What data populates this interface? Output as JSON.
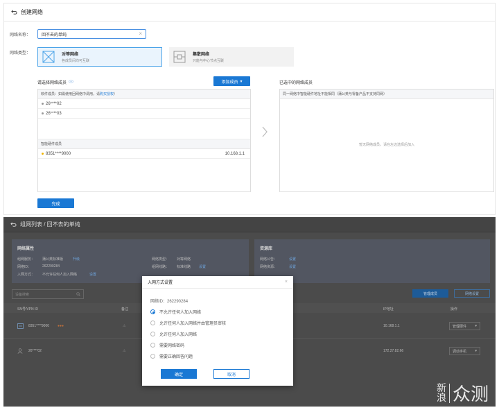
{
  "create": {
    "title": "创建网络",
    "name_label": "网络名称：",
    "name_value": "回不去的单纯",
    "type_label": "网络类型：",
    "types": [
      {
        "name": "对等网络",
        "desc": "各成员间均可互联"
      },
      {
        "name": "集散网络",
        "desc": "只能与中心节点互联"
      }
    ],
    "select_title": "请选择网络成员",
    "add_button": "添加成员",
    "software_header": "软件成员：如需使用回网络中调用，请",
    "software_header_link": "购买授权",
    "software_header_end": "）",
    "software_members": [
      "26****02",
      "26****03"
    ],
    "hardware_header": "智能硬件成员",
    "hardware_members": [
      {
        "id": "8351****9000",
        "ip": "10.168.1.1"
      }
    ],
    "selected_title": "已选中的网络成员",
    "selected_header": "同一网络中智能硬件地址不能相同（蒲公英与零备产品不支持同网）",
    "selected_empty": "暂无网络成员，请在左边选择后加入",
    "done_button": "完成"
  },
  "detail": {
    "title": "组网列表 / 回不去的单纯",
    "attr_title": "网络属性",
    "attr_rows": [
      {
        "label": "组网服务：",
        "value": "蒲公英标准版",
        "link": "升级"
      },
      {
        "label": "网络ID：",
        "value": "262290284",
        "link": ""
      },
      {
        "label": "入网方式：",
        "value": "不允许任何人加入网络",
        "link": "设置"
      }
    ],
    "attr_rows_right": [
      {
        "label": "网络类型：",
        "value": "对等网络",
        "link": ""
      },
      {
        "label": "组网线路：",
        "value": "标准线路",
        "link": "设置"
      },
      {
        "label": "限制：",
        "value": "硬件 1  软件 3",
        "link": ""
      }
    ],
    "resource_title": "资源库",
    "resource_rows": [
      {
        "label": "网络公告：",
        "link": "设置"
      },
      {
        "label": "网络资源：",
        "link": "设置"
      }
    ],
    "search_placeholder": "设备搜索",
    "manage_button": "管理成员",
    "delete_button": "网络设置",
    "col_id": "SN号/VPN ID",
    "col_note": "备注",
    "col_ip": "IP地址",
    "col_op": "操作",
    "rows": [
      {
        "id": "8351****9000",
        "badge": "●●●",
        "ip": "10.168.1.1",
        "op": "管理硬件"
      },
      {
        "id": "26****02",
        "badge": "",
        "ip": "172.27.82.66",
        "op": "调动手机"
      }
    ]
  },
  "modal": {
    "title": "入网方式设置",
    "id_line": "网络ID：262290284",
    "options": [
      "不允许任何人加入网络",
      "允许任何人加入网络并由管理员审核",
      "允许任何人加入网络",
      "需要网络密码",
      "需要正确回答问题"
    ],
    "selected_index": 0,
    "ok": "确定",
    "cancel": "取消"
  },
  "watermark": {
    "line1": "新",
    "line2": "浪",
    "big": "众测"
  }
}
